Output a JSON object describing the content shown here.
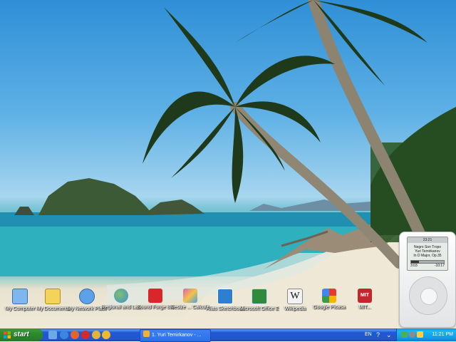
{
  "desktop": {
    "icons": [
      {
        "label": "My Computer",
        "icon": "my-computer-icon",
        "color": "#7db7ee"
      },
      {
        "label": "My Documents",
        "icon": "my-documents-icon",
        "color": "#f3d35a"
      },
      {
        "label": "My Network Places",
        "icon": "network-places-icon",
        "color": "#5da2e8"
      },
      {
        "label": "Regional and Language...",
        "icon": "globe-icon",
        "color": "#3f8fd8"
      },
      {
        "label": "Sound Forge 8.0",
        "icon": "sound-forge-icon",
        "color": "#d8262a"
      },
      {
        "label": "Resize ... Calculator",
        "icon": "calculator-icon",
        "color": "#e05fb0"
      },
      {
        "label": "Alias Sketchbook",
        "icon": "sketchbook-icon",
        "color": "#2f7fd0"
      },
      {
        "label": "Microsoft Office Excel",
        "icon": "excel-icon",
        "color": "#2e8b3d"
      },
      {
        "label": "Wikipedia",
        "icon": "wikipedia-icon",
        "color": "#f2f2f2"
      },
      {
        "label": "Google Picasa",
        "icon": "google-icon",
        "color": "#3a9a4a"
      },
      {
        "label": "MIT...",
        "icon": "mit-icon",
        "color": "#c0282d"
      }
    ]
  },
  "ipod": {
    "time": "23:21",
    "lines": [
      "Negro Son Tropo",
      "Yuri Temirkanov",
      "In D Major, Op.35"
    ],
    "counter_left": "3:03",
    "counter_right": "-10:17",
    "progress": 0.23
  },
  "taskbar": {
    "start_label": "start",
    "task_label": "1. Yuri Temirkanov - ...",
    "language": "EN",
    "clock": "11:21 PM",
    "quick_launch": [
      {
        "icon": "show-desktop-icon",
        "color": "#6fa8e6"
      },
      {
        "icon": "internet-explorer-icon",
        "color": "#3b87de"
      },
      {
        "icon": "firefox-icon",
        "color": "#e2662b"
      },
      {
        "icon": "opera-icon",
        "color": "#d32a2a"
      },
      {
        "icon": "chrome-icon",
        "color": "#e5b23a"
      },
      {
        "icon": "media-player-icon",
        "color": "#f0b82c"
      }
    ]
  }
}
